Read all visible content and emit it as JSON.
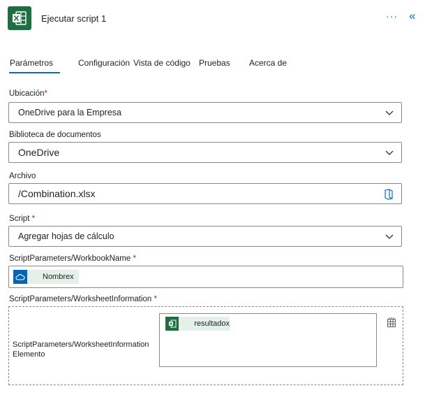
{
  "header": {
    "app_icon": "excel-icon",
    "title": "Ejecutar script 1",
    "more_icon": "ellipsis-icon",
    "collapse_icon": "double-chevron-left-icon"
  },
  "tabs": [
    {
      "label": "Parámetros",
      "active": true
    },
    {
      "label": "Configuración",
      "active": false
    },
    {
      "label": "Vista de código",
      "active": false
    },
    {
      "label": "Pruebas",
      "active": false
    },
    {
      "label": "Acerca de",
      "active": false
    }
  ],
  "form": {
    "location": {
      "label": "Ubicación",
      "required_mark": "*",
      "value": "OneDrive para la Empresa"
    },
    "library": {
      "label": "Biblioteca de documentos",
      "value": "OneDrive"
    },
    "file": {
      "label": "Archivo",
      "value": "/Combination.xlsx",
      "icon": "file-picker-icon"
    },
    "script": {
      "label": "Script ",
      "required_mark": "*",
      "value": "Agregar hojas de cálculo"
    },
    "workbook_name": {
      "label": "ScriptParameters/WorkbookName ",
      "required_mark": "*",
      "token_text": "Nombre",
      "token_close": "x",
      "token_icon": "onedrive-cloud-icon"
    },
    "worksheet_info": {
      "label": "ScriptParameters/WorksheetInformation ",
      "required_mark": "*",
      "item_label_line1": "ScriptParameters/WorksheetInformation",
      "item_label_line2": "Elemento",
      "token_text": "resultado",
      "token_close": "x",
      "token_icon": "excel-icon",
      "switch_icon": "switch-to-array-icon"
    }
  },
  "colors": {
    "accent": "#0f6cbd",
    "excel": "#1d6f42",
    "onedrive": "#0364b8",
    "required": "#a4262c"
  }
}
